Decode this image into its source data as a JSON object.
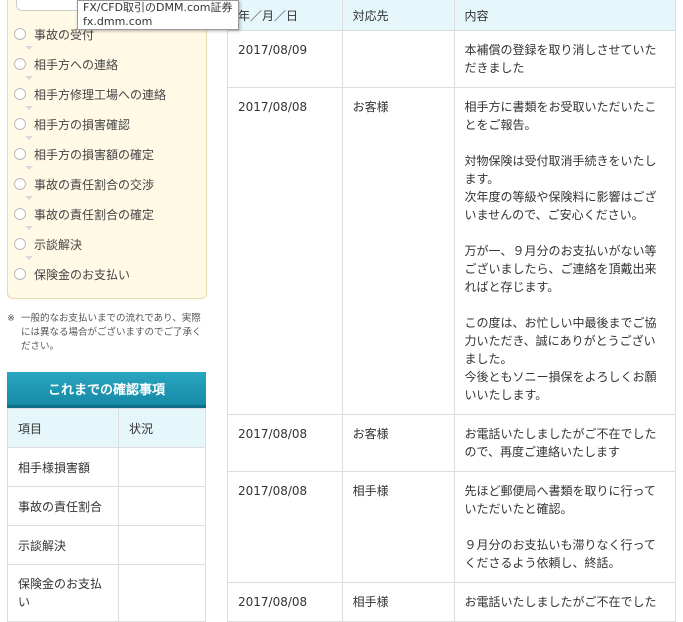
{
  "tooltip": {
    "line1": "FX/CFD取引のDMM.com証券",
    "line2": "fx.dmm.com"
  },
  "steps": [
    {
      "label": "事故の受付"
    },
    {
      "label": "相手方への連絡"
    },
    {
      "label": "相手方修理工場への連絡"
    },
    {
      "label": "相手方の損害確認"
    },
    {
      "label": "相手方の損害額の確定"
    },
    {
      "label": "事故の責任割合の交渉"
    },
    {
      "label": "事故の責任割合の確定"
    },
    {
      "label": "示談解決"
    },
    {
      "label": "保険金のお支払い"
    }
  ],
  "note": {
    "mark": "※",
    "text": "一般的なお支払いまでの流れであり、実際には異なる場合がございますのでご了承ください。"
  },
  "confirm": {
    "title": "これまでの確認事項",
    "headers": [
      "項目",
      "状況"
    ],
    "rows": [
      {
        "item": "相手様損害額",
        "status": ""
      },
      {
        "item": "事故の責任割合",
        "status": ""
      },
      {
        "item": "示談解決",
        "status": ""
      },
      {
        "item": "保険金のお支払い",
        "status": ""
      }
    ]
  },
  "history": {
    "headers": [
      "年／月／日",
      "対応先",
      "内容"
    ],
    "rows": [
      {
        "date": "2017/08/09",
        "party": "",
        "paragraphs": [
          "本補償の登録を取り消しさせていただきました"
        ]
      },
      {
        "date": "2017/08/08",
        "party": "お客様",
        "paragraphs": [
          "相手方に書類をお受取いただいたことをご報告。",
          "",
          "対物保険は受付取消手続きをいたします。",
          "次年度の等級や保険料に影響はございませんので、ご安心ください。",
          "",
          "万が一、９月分のお支払いがない等ございましたら、ご連絡を頂戴出来ればと存じます。",
          "",
          "この度は、お忙しい中最後までご協力いただき、誠にありがとうございました。",
          "今後ともソニー損保をよろしくお願いいたします。"
        ]
      },
      {
        "date": "2017/08/08",
        "party": "お客様",
        "paragraphs": [
          "お電話いたしましたがご不在でしたので、再度ご連絡いたします"
        ]
      },
      {
        "date": "2017/08/08",
        "party": "相手様",
        "paragraphs": [
          "先ほど郵便局へ書類を取りに行っていただいたと確認。",
          "",
          "９月分のお支払いも滞りなく行ってくださるよう依頼し、終話。"
        ]
      },
      {
        "date": "2017/08/08",
        "party": "相手様",
        "paragraphs": [
          "お電話いたしましたがご不在でした"
        ]
      }
    ]
  }
}
